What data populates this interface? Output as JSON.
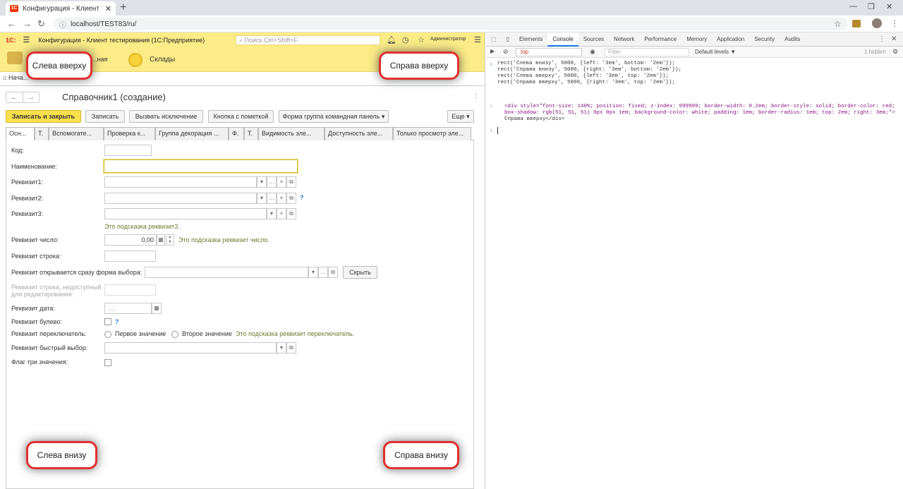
{
  "browser": {
    "tab_title": "Конфигурация - Клиент тестир...",
    "url": "localhost/TEST83/ru/"
  },
  "app": {
    "logo": "1С:",
    "title": "Конфигурация  - Клиент тестирования (1С:Предприятие)",
    "search_placeholder": "Поиск Ctrl+Shift+F",
    "user": "Администратор",
    "section2": "...ная",
    "section3": "Склады",
    "home_tab": "Нача...",
    "form_title": "Справочник1 (создание)",
    "buttons": {
      "save_close": "Записать и закрыть",
      "save": "Записать",
      "raise": "Вызвать исключение",
      "mark": "Кнопка с пометкой",
      "group": "Форма группа командная панель",
      "more": "Еще"
    },
    "tabs": [
      "Осн...",
      "Т.",
      "Вспомогате...",
      "Проверка к...",
      "Группа декорация ...",
      "Ф.",
      "Т.",
      "Видимость эле...",
      "Доступность эле...",
      "Только просмотр эле..."
    ],
    "fields": {
      "code": "Код:",
      "name": "Наименование:",
      "r1": "Реквизит1:",
      "r2": "Реквизит2:",
      "r3": "Реквизит3:",
      "r3_hint": "Это подсказка реквизит3.",
      "num": "Реквизит число:",
      "num_value": "0,00",
      "num_hint": "Это подсказка реквизит число.",
      "str": "Реквизит строка:",
      "choice": "Реквизит открывается сразу форма выбора:",
      "hide_btn": "Скрыть",
      "str_disabled": "Реквизит строка, недоступный для редактирования:",
      "date": "Реквизит дата:",
      "date_value": "  .  .",
      "bool": "Реквизит булево:",
      "switch": "Реквизит переключатель:",
      "opt1": "Первое значение",
      "opt2": "Второе значение",
      "switch_hint": "Это подсказка реквизит переключатель.",
      "quick": "Реквизит быстрый выбор:",
      "flag3": "Флаг три значения:"
    },
    "callouts": {
      "tl": "Слева вверху",
      "tr": "Справа вверху",
      "bl": "Слева внизу",
      "br": "Справа внизу"
    }
  },
  "devtools": {
    "tabs": [
      "Elements",
      "Console",
      "Sources",
      "Network",
      "Performance",
      "Memory",
      "Application",
      "Security",
      "Audits"
    ],
    "context": "top",
    "filter_placeholder": "Filter",
    "levels": "Default levels ▼",
    "hidden": "1 hidden",
    "lines": [
      "rect('Слева внизу', 5000, {left: '3em', bottom: '2em'});",
      "rect('Справа внизу', 5000, {right: '3em', bottom: '2em'});",
      "rect('Слева вверху', 5000, {left: '3em', top: '2em'});",
      "rect('Справа вверху', 5000, {right: '3em', top: '2em'});"
    ],
    "out1": "<div style=\"font-size: 140%; position: fixed; z-index: 999999; border-width: 0.2em; border-style: solid; border-color: red;",
    "out2": "box-shadow: rgb(51, 51, 51) 0px 0px 1em; background-color: white; padding: 1em; border-radius: 1em; top: 2em; right: 3em;\">",
    "out3": "Справа вверху</div>"
  }
}
